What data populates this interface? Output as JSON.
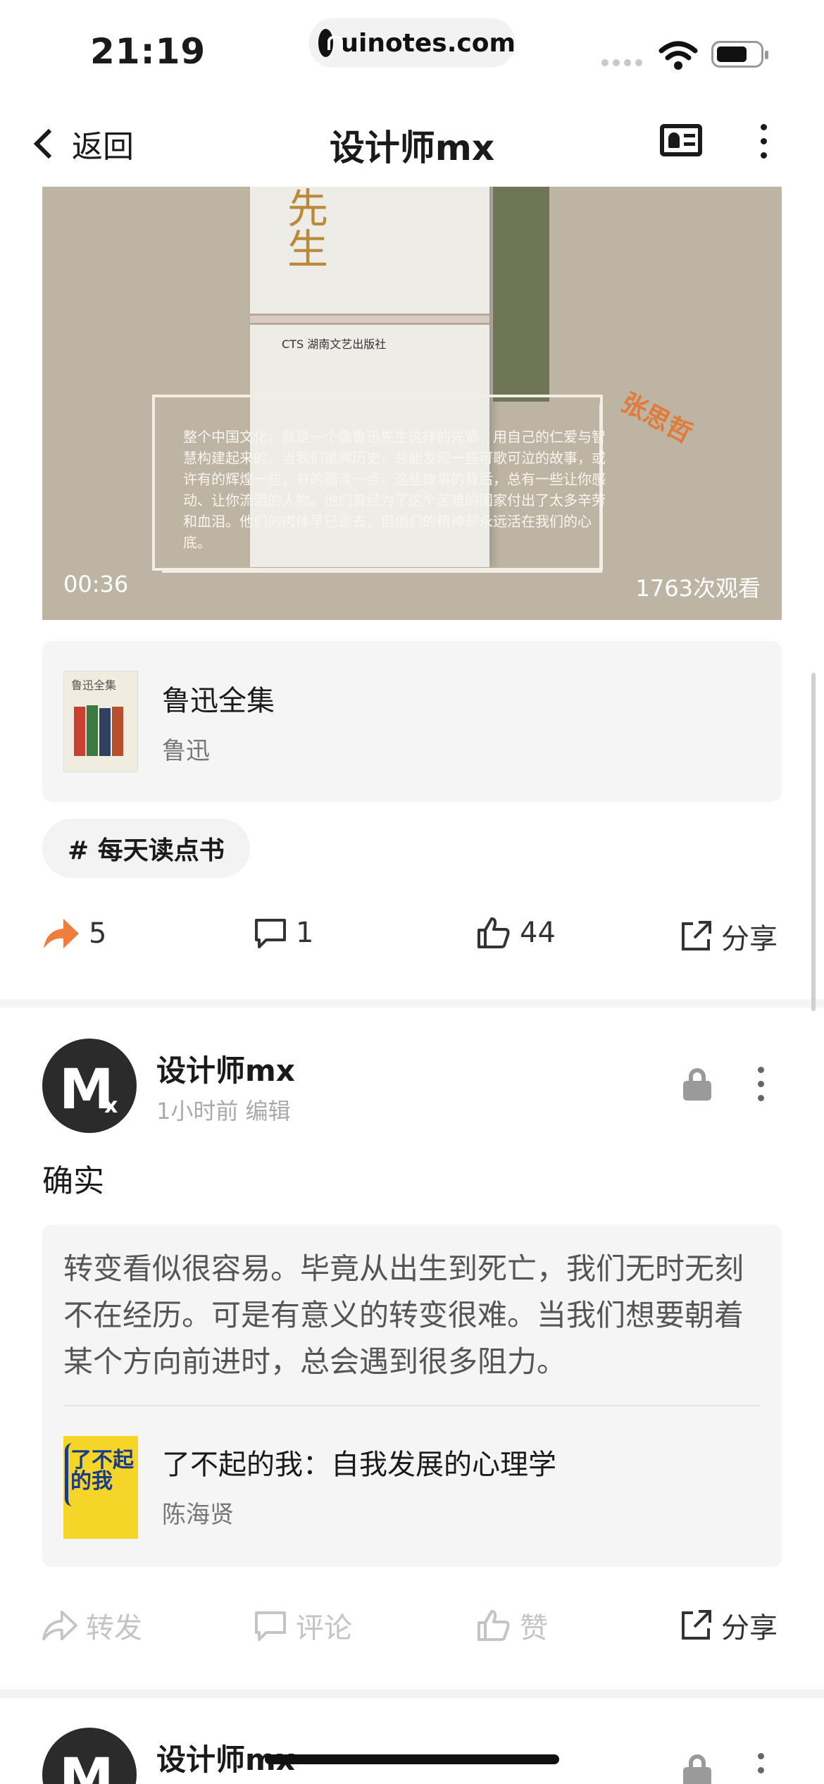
{
  "status_bar": {
    "time": "21:19",
    "url": "uinotes.com"
  },
  "nav": {
    "back_label": "返回",
    "title": "设计师mx"
  },
  "video": {
    "book_title": "先生",
    "quote": "整个中国文化，就是一个像鲁迅先生这样的先贤，用自己的仁爱与智慧构建起来的。当我们追溯历史，总能发现一些可歌可泣的故事，或许有的辉煌一些，有的黯淡一点。这些故事的背后，总有一些让你感动、让你流泪的人物。他们曾经为了这个苦难的国家付出了太多辛劳和血泪。他们的肉体早已逝去，但他们的精神却永远活在我们的心底。",
    "author_tag": "张思哲",
    "duration": "00:36",
    "views": "1763次观看"
  },
  "book_card": {
    "title": "鲁迅全集",
    "author": "鲁迅",
    "thumb_text": "鲁迅全集"
  },
  "tag": {
    "label": "# 每天读点书"
  },
  "post1_actions": {
    "repost_count": "5",
    "comment_count": "1",
    "like_count": "44",
    "share_label": "分享"
  },
  "post2": {
    "author": "设计师mx",
    "meta": "1小时前  编辑",
    "text": "确实",
    "quote": "转变看似很容易。毕竟从出生到死亡，我们无时无刻不在经历。可是有意义的转变很难。当我们想要朝着某个方向前进时，总会遇到很多阻力。",
    "book_title": "了不起的我：自我发展的心理学",
    "book_author": "陈海贤",
    "thumb_text": "了不起的我"
  },
  "post2_actions": {
    "repost_label": "转发",
    "comment_label": "评论",
    "like_label": "赞",
    "share_label": "分享"
  },
  "post3": {
    "author": "设计师mx"
  },
  "avatar": {
    "letter": "M",
    "sub": "x"
  },
  "icons": [
    "lock-icon",
    "wifi-icon",
    "battery-icon",
    "back-chevron-icon",
    "contact-card-icon",
    "more-vertical-icon",
    "repost-arrow-icon",
    "comment-icon",
    "like-icon",
    "share-icon"
  ],
  "colors": {
    "accent_orange": "#f07d3c",
    "grey_text": "#aaaaaa",
    "card_bg": "#f5f5f5"
  }
}
